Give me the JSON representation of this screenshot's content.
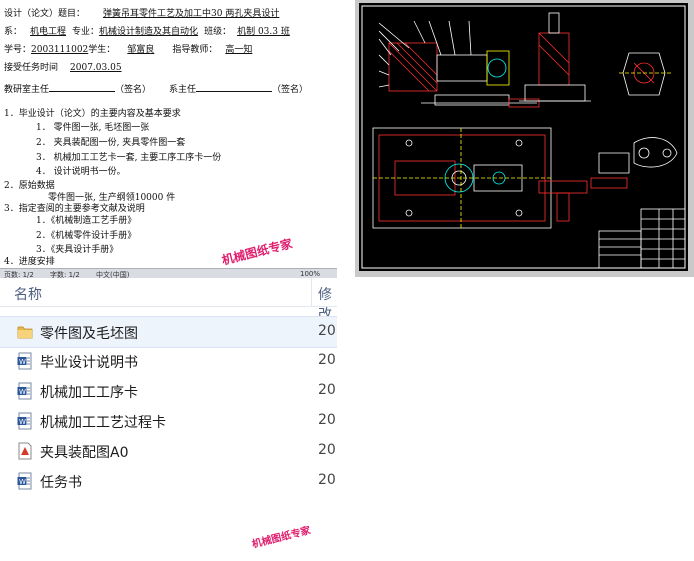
{
  "document": {
    "l1": [
      "设计（论文）题目：",
      "弹簧吊耳零件工艺及加工中30 两孔夹具设计"
    ],
    "l2": [
      "系：",
      "机电工程",
      "专业：",
      "机械设计制造及其自动化",
      "班级：",
      "机制 03.3 班"
    ],
    "l3": [
      "学号：",
      "2003111002",
      "学生：",
      "邹富良",
      "指导教师：",
      "高一知"
    ],
    "l4": [
      "接受任务时间",
      "2007.03.05"
    ],
    "l5": [
      "教研室主任",
      "（签名）",
      "系主任",
      "（签名）"
    ],
    "s1": "1．毕业设计（论文）的主要内容及基本要求",
    "s1_items": [
      "1．  零件图一张, 毛坯图一张",
      "2．  夹具装配图一份, 夹具零件图一套",
      "3．  机械加工工艺卡一套, 主要工序工序卡一份",
      "4．  设计说明书一份。"
    ],
    "s2": "2．原始数据",
    "s2_item": "零件图一张, 生产纲领10000 件",
    "s3": "3．指定查阅的主要参考文献及说明",
    "s3_items": [
      "1．《机械制造工艺手册》",
      "2．《机械零件设计手册》",
      "3．《夹具设计手册》"
    ],
    "s4": "4．进度安排",
    "status": [
      "页数: 1/2",
      "字数: 1/2",
      "中文(中国)",
      "100%"
    ]
  },
  "watermark": "机械图纸专家",
  "cad": {
    "accent": "#ff2020",
    "line_color": "#ffffff",
    "hatch_color": "#ff3030"
  },
  "file_list": {
    "columns": [
      "名称",
      "修改"
    ],
    "rows": [
      {
        "name": "零件图及毛坯图",
        "date": "20",
        "icon": "folder-icon"
      },
      {
        "name": "毕业设计说明书",
        "date": "20",
        "icon": "word-doc-icon"
      },
      {
        "name": "机械加工工序卡",
        "date": "20",
        "icon": "word-doc-icon"
      },
      {
        "name": "机械加工工艺过程卡",
        "date": "20",
        "icon": "word-doc-icon"
      },
      {
        "name": "夹具装配图A0",
        "date": "20",
        "icon": "cad-file-icon"
      },
      {
        "name": "任务书",
        "date": "20",
        "icon": "word-doc-icon"
      }
    ]
  }
}
